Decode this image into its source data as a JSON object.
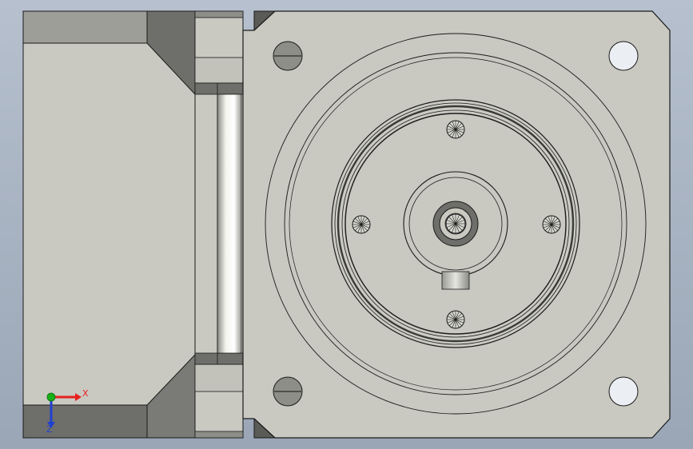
{
  "viewport": {
    "background_top": "#b6c0ce",
    "background_bottom": "#9aa6b6"
  },
  "colors": {
    "face": "#c9c9c1",
    "face_light": "#d2d2ca",
    "edge": "#1a1a1a",
    "shadow": "#6e6e6a",
    "shadow_dark": "#5a5a57",
    "hole": "#ebeff4",
    "axis_x": "#e82020",
    "axis_y": "#18b018",
    "axis_z": "#2040d0"
  },
  "triad": {
    "x_label": "X",
    "z_label": "Z",
    "x_icon": "x-axis-arrow-icon",
    "y_icon": "y-axis-point-icon",
    "z_icon": "z-axis-arrow-icon"
  }
}
